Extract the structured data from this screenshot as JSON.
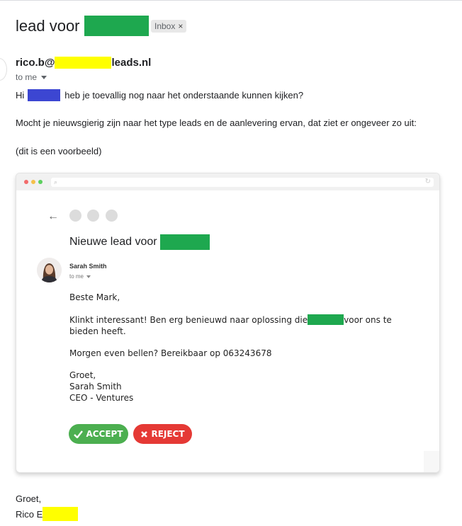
{
  "header": {
    "subject": "lead voor",
    "label_badge": "Inbox",
    "label_close": "×"
  },
  "sender": {
    "email_prefix": "rico.b@",
    "email_suffix": "leads.nl",
    "to": "to me"
  },
  "message": {
    "greeting_start": "Hi",
    "greeting_rest": "heb je toevallig nog naar het onderstaande kunnen kijken?",
    "line2": "Mocht je nieuwsgierig zijn naar het type leads en de aanlevering ervan, dat ziet er ongeveer zo uit:",
    "line3": "(dit is een voorbeeld)",
    "closing": "Groet,",
    "signature_start": "Rico E"
  },
  "embedded": {
    "subject": "Nieuwe lead voor",
    "sender_name": "Sarah Smith",
    "to": "to me",
    "salutation": "Beste Mark,",
    "p1_start": "Klinkt interessant! Ben erg benieuwd naar oplossing die",
    "p1_end": "voor ons te",
    "p1_line2": "bieden heeft.",
    "p2": "Morgen even bellen? Bereikbaar op 063243678",
    "closing": "Groet,",
    "sig_name": "Sarah Smith",
    "sig_title": "CEO - Ventures",
    "accept_label": "ACCEPT",
    "reject_label": "REJECT"
  },
  "colors": {
    "redaction_green": "#1ea84f",
    "redaction_yellow": "#ffff00",
    "redaction_blue": "#3c46d2",
    "accept": "#4caf50",
    "reject": "#e53935"
  },
  "icons": [
    "back-arrow-icon",
    "chevron-down-icon",
    "check-icon",
    "x-icon",
    "search-icon",
    "reload-icon"
  ]
}
